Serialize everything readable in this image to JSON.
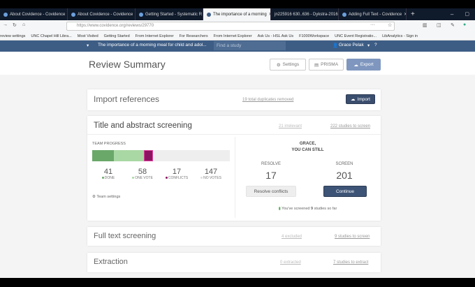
{
  "browser": {
    "tabs": [
      {
        "title": "About Covidence - Covidence"
      },
      {
        "title": "About Covidence - Covidence"
      },
      {
        "title": "Getting Started - Systematic R"
      },
      {
        "title": "The importance of a morning"
      },
      {
        "title": "jn225916 630..636 - Dykstra-2016"
      },
      {
        "title": "Adding Full Text - Covidence"
      }
    ],
    "url": "https://www.covidence.org/reviews/29770",
    "bookmarks": [
      "review settings",
      "UNC Chapel Hill Libra...",
      "Most Visited",
      "Getting Started",
      "From Internet Explorer",
      "For Researchers",
      "From Internet Explorer",
      "Ask Us - HSL Ask Us",
      "F1000Workspace",
      "UNC Event Registratio...",
      "LibAnalytics - Sign in"
    ]
  },
  "app": {
    "review_title": "The importance of a morning meal for child and adol...",
    "search_placeholder": "Find a study",
    "user": "Grace Pelak"
  },
  "summary": {
    "title": "Review Summary",
    "settings": "Settings",
    "prisma": "PRISMA",
    "export": "Export"
  },
  "import": {
    "title": "Import references",
    "duplicates": "19 total duplicates removed",
    "button": "Import"
  },
  "screening": {
    "title": "Title and abstract screening",
    "irrelevant": "21 irrelevant",
    "to_screen": "222 studies to screen",
    "team_progress": "TEAM PROGRESS",
    "progress": {
      "done": 41,
      "one_vote": 58,
      "conflicts": 17,
      "no_votes": 147
    },
    "stats": [
      {
        "value": "41",
        "label": "DONE",
        "color": "#6aa86a"
      },
      {
        "value": "58",
        "label": "ONE VOTE",
        "color": "#aad8a4"
      },
      {
        "value": "17",
        "label": "CONFLICTS",
        "color": "#8b1460"
      },
      {
        "value": "147",
        "label": "NO VOTES",
        "color": "#ddd"
      }
    ],
    "team_settings": "Team settings",
    "greeting1": "GRACE,",
    "greeting2": "YOU CAN STILL",
    "resolve_label": "RESOLVE",
    "resolve_value": "17",
    "screen_label": "SCREEN",
    "screen_value": "201",
    "resolve_button": "Resolve conflicts",
    "continue_button": "Continue",
    "screened_prefix": "You've screened ",
    "screened_count": "9",
    "screened_suffix": " studies so far"
  },
  "fulltext": {
    "title": "Full text screening",
    "excluded": "4 excluded",
    "to_screen": "9 studies to screen"
  },
  "extraction": {
    "title": "Extraction",
    "extracted": "0 extracted",
    "to_extract": "7 studies to extract"
  }
}
